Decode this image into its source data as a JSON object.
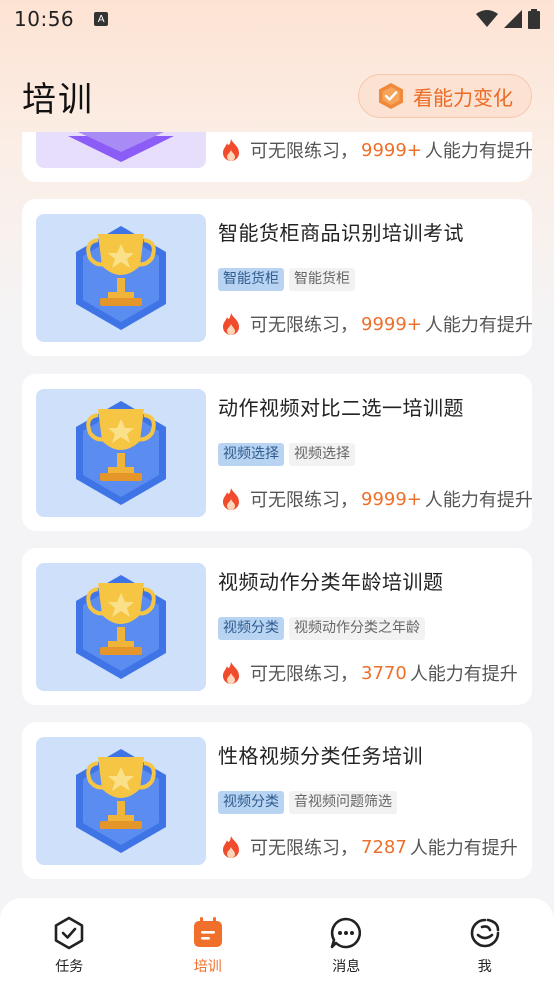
{
  "status_bar": {
    "time": "10:56",
    "notification_glyph": "A"
  },
  "header": {
    "title": "培训",
    "ability_button_label": "看能力变化"
  },
  "practice": {
    "prefix": "可无限练习，",
    "suffix": "人能力有提升"
  },
  "cards": [
    {
      "title": "",
      "tags": [],
      "count": "9999+"
    },
    {
      "title": "智能货柜商品识别培训考试",
      "tags": [
        "智能货柜",
        "智能货柜"
      ],
      "count": "9999+"
    },
    {
      "title": "动作视频对比二选一培训题",
      "tags": [
        "视频选择",
        "视频选择"
      ],
      "count": "9999+"
    },
    {
      "title": "视频动作分类年龄培训题",
      "tags": [
        "视频分类",
        "视频动作分类之年龄"
      ],
      "count": "3770"
    },
    {
      "title": "性格视频分类任务培训",
      "tags": [
        "视频分类",
        "音视频问题筛选"
      ],
      "count": "7287"
    }
  ],
  "tabs": [
    {
      "label": "任务",
      "icon": "task-check-icon"
    },
    {
      "label": "培训",
      "icon": "training-icon",
      "active": true
    },
    {
      "label": "消息",
      "icon": "message-icon"
    },
    {
      "label": "我",
      "icon": "profile-icon"
    }
  ],
  "colors": {
    "accent": "#ef6f2b",
    "tag_bg": "#b9d4f2",
    "thumb_bg": "#cfe0fb"
  }
}
